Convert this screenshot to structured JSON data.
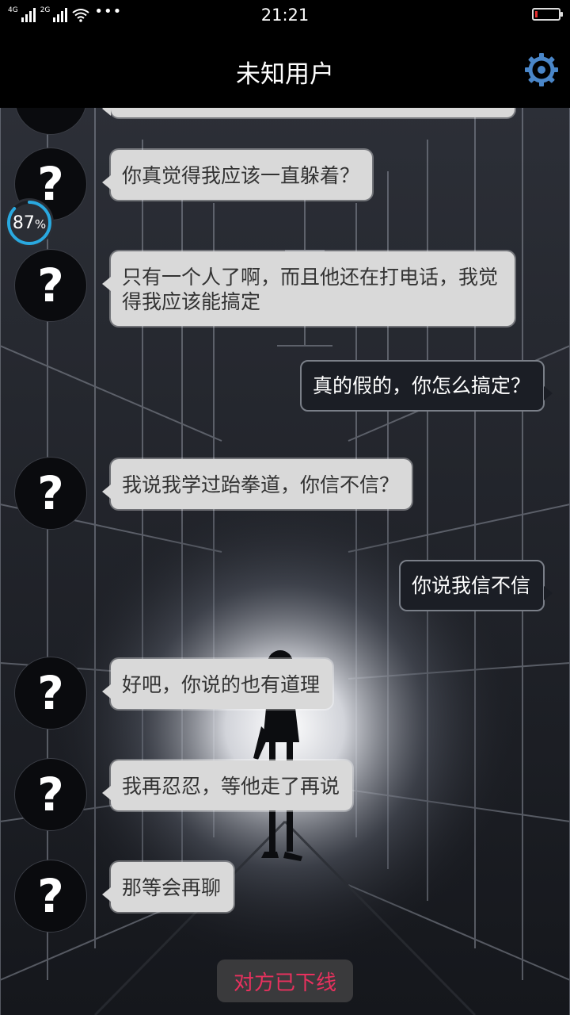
{
  "status_bar": {
    "network_top": "4G",
    "network_bottom": "2G",
    "more": "•••",
    "time": "21:21",
    "battery_level": 0.1
  },
  "header": {
    "title": "未知用户",
    "settings_icon": "gear-icon"
  },
  "progress_badge": {
    "value": "87",
    "unit": "%"
  },
  "avatar_symbol": "?",
  "messages": [
    {
      "side": "in",
      "text": "你真觉得我应该一直躲着？"
    },
    {
      "side": "in",
      "text": "只有一个人了啊，而且他还在打电话，我觉得我应该能搞定"
    },
    {
      "side": "out",
      "text": "真的假的，你怎么搞定？"
    },
    {
      "side": "in",
      "text": "我说我学过跆拳道，你信不信？"
    },
    {
      "side": "out",
      "text": "你说我信不信"
    },
    {
      "side": "in",
      "text": "好吧，你说的也有道理"
    },
    {
      "side": "in",
      "text": "我再忍忍，等他走了再说"
    },
    {
      "side": "in",
      "text": "那等会再聊"
    }
  ],
  "offline_notice": "对方已下线",
  "colors": {
    "offline_text": "#e8315e",
    "gear": "#4a86c8",
    "progress_ring": "#2aa9e0"
  }
}
